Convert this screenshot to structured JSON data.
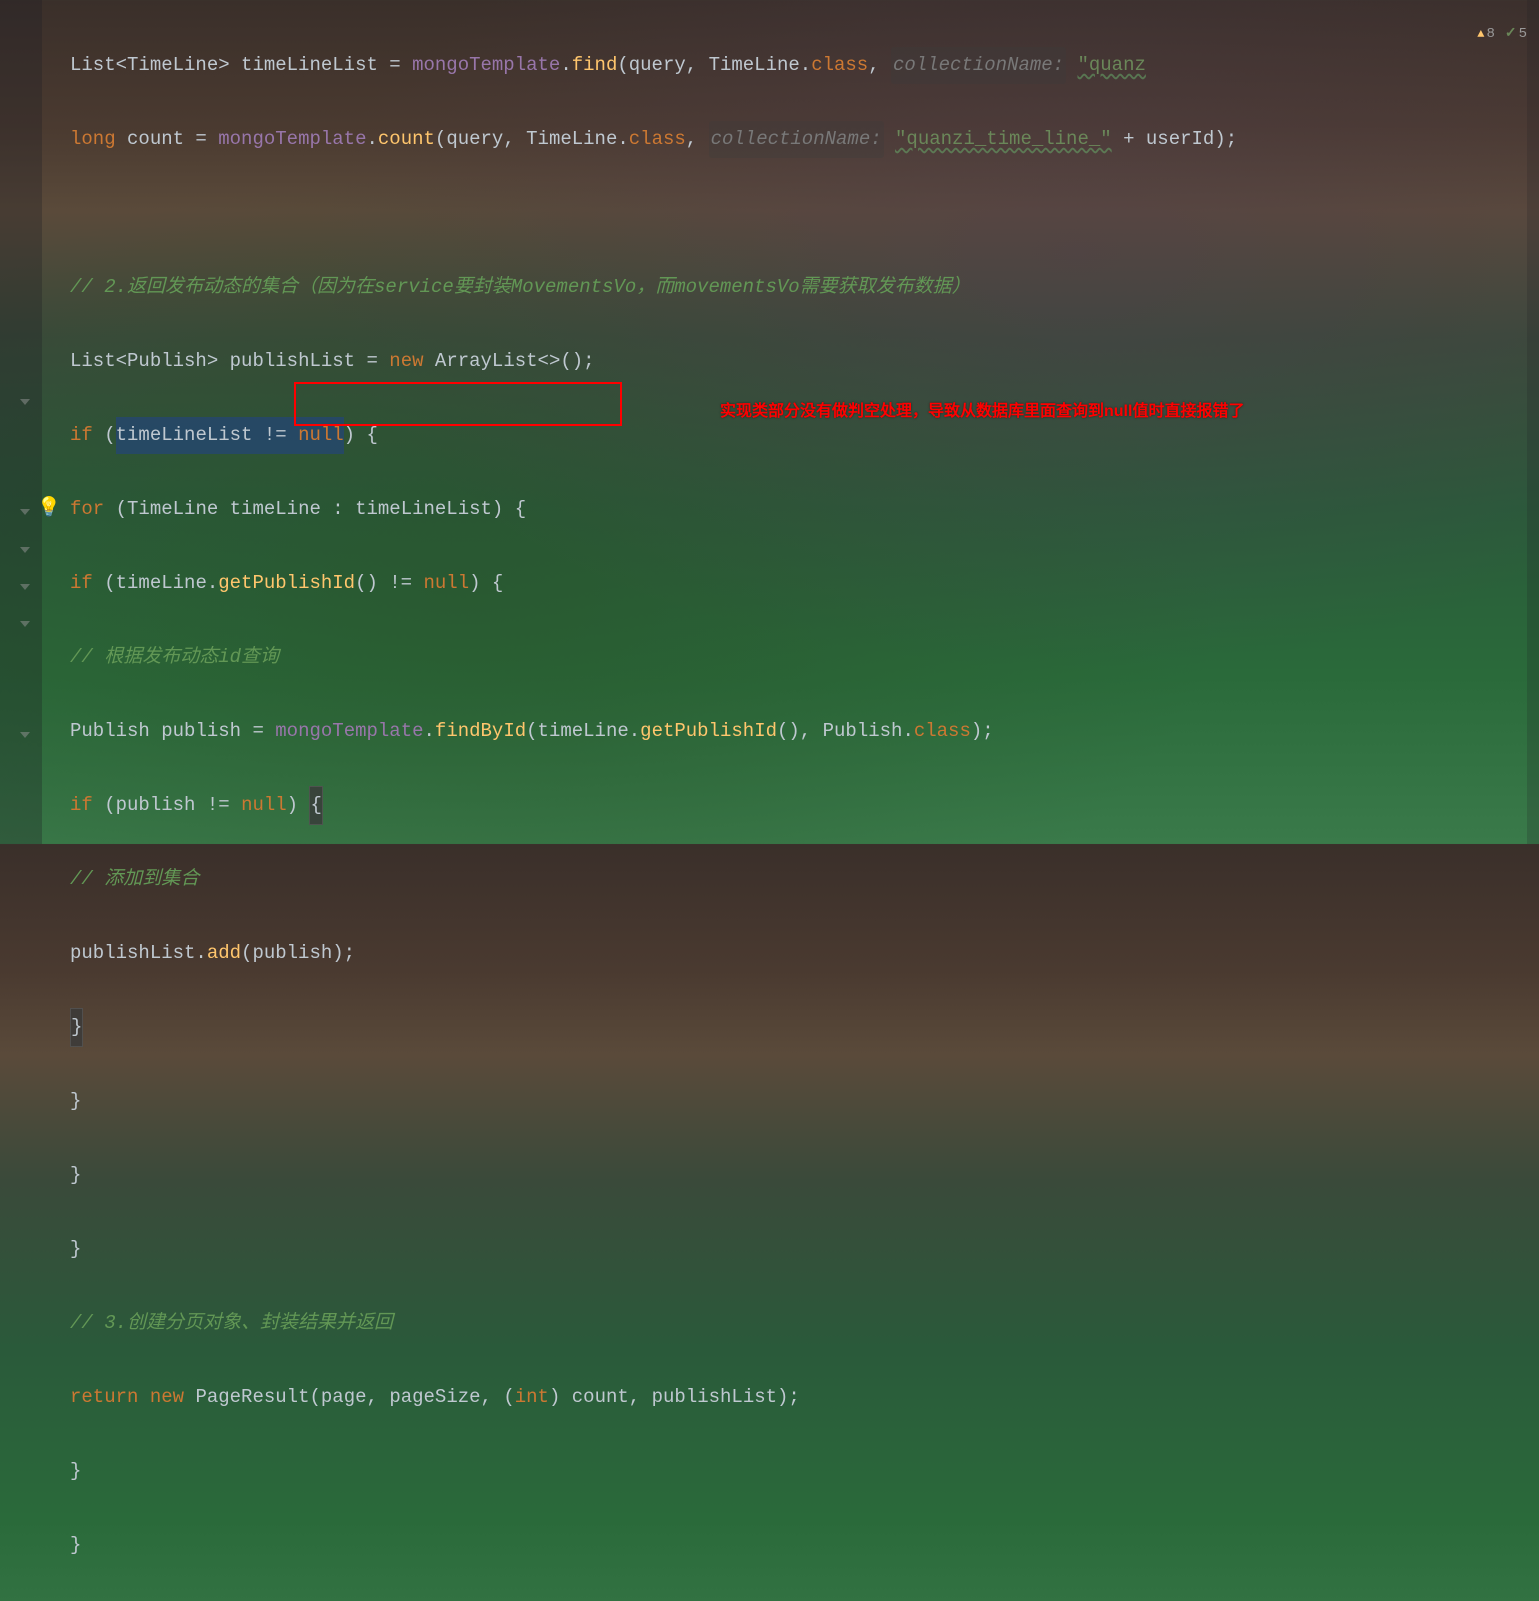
{
  "indicators": {
    "warnings": "8",
    "ok": "5"
  },
  "annotation": "实现类部分没有做判空处理，导致从数据库里面查询到null值时直接报错了",
  "code": {
    "l1": {
      "t1": "List<TimeLine> timeLineList = mongoTemplate",
      "p1": "List",
      "p2": "TimeLine",
      "p3": "timeLineList",
      "p4": "mongoTemplate",
      "p5": "find",
      "p6": "query",
      "p7": "TimeLine",
      "p8": "class",
      "hint": "collectionName:",
      "str": "\"quanz"
    },
    "l2": {
      "kw": "long",
      "var": "count",
      "field": "mongoTemplate",
      "method": "count",
      "arg1": "query",
      "cls": "TimeLine",
      "clsattr": "class",
      "hint": "collectionName:",
      "str": "\"quanzi_time_line_\"",
      "var2": "userId"
    },
    "l4": {
      "comment": "// 2.返回发布动态的集合（因为在service要封装MovementsVo，而movementsVo需要获取发布数据）"
    },
    "l5": {
      "p1": "List",
      "p2": "Publish",
      "p3": "publishList",
      "kw": "new",
      "p4": "ArrayList"
    },
    "l6": {
      "kw": "if",
      "var": "timeLineList",
      "kw2": "null"
    },
    "l7": {
      "kw": "for",
      "cls": "TimeLine",
      "var": "timeLine",
      "var2": "timeLineList"
    },
    "l8": {
      "kw": "if",
      "var": "timeLine",
      "method": "getPublishId",
      "kw2": "null"
    },
    "l9": {
      "comment": "// 根据发布动态id查询"
    },
    "l10": {
      "cls": "Publish",
      "var": "publish",
      "field": "mongoTemplate",
      "method": "findById",
      "var2": "timeLine",
      "method2": "getPublishId",
      "cls2": "Publish",
      "attr": "class"
    },
    "l11": {
      "kw": "if",
      "var": "publish",
      "kw2": "null"
    },
    "l12": {
      "comment": "// 添加到集合"
    },
    "l13": {
      "var": "publishList",
      "method": "add",
      "arg": "publish"
    },
    "l18": {
      "comment": "// 3.创建分页对象、封装结果并返回"
    },
    "l19": {
      "kw": "return",
      "kw2": "new",
      "cls": "PageResult",
      "a1": "page",
      "a2": "pageSize",
      "cast": "int",
      "a3": "count",
      "a4": "publishList"
    }
  }
}
